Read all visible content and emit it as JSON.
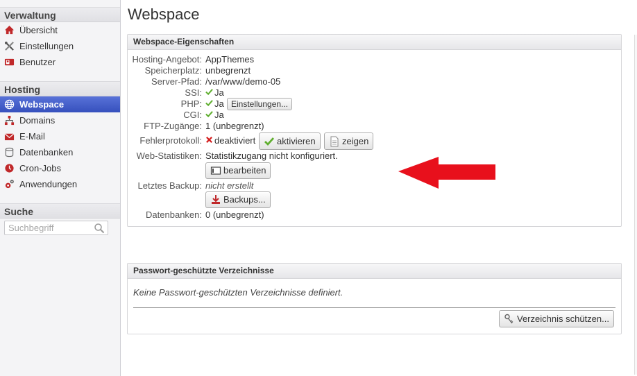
{
  "sidebar": {
    "verwaltung_title": "Verwaltung",
    "verwaltung_items": [
      "Übersicht",
      "Einstellungen",
      "Benutzer"
    ],
    "hosting_title": "Hosting",
    "hosting_items": [
      "Webspace",
      "Domains",
      "E-Mail",
      "Datenbanken",
      "Cron-Jobs",
      "Anwendungen"
    ],
    "active_item": "Webspace",
    "suche_title": "Suche",
    "search_placeholder": "Suchbegriff"
  },
  "main": {
    "page_title": "Webspace",
    "panel1": {
      "title": "Webspace-Eigenschaften",
      "rows": {
        "hosting_label": "Hosting-Angebot:",
        "hosting_value": "AppThemes",
        "speicher_label": "Speicherplatz:",
        "speicher_value": "unbegrenzt",
        "serverpfad_label": "Server-Pfad:",
        "serverpfad_value": "/var/www/demo-05",
        "ssi_label": "SSI:",
        "ssi_value": "Ja",
        "php_label": "PHP:",
        "php_value": "Ja",
        "php_button": "Einstellungen...",
        "cgi_label": "CGI:",
        "cgi_value": "Ja",
        "ftp_label": "FTP-Zugänge:",
        "ftp_value": "1 (unbegrenzt)",
        "fehler_label": "Fehlerprotokoll:",
        "fehler_value": "deaktiviert",
        "aktivieren_button": "aktivieren",
        "zeigen_button": "zeigen",
        "webstat_label": "Web-Statistiken:",
        "webstat_value": "Statistikzugang nicht konfiguriert.",
        "bearbeiten_button": "bearbeiten",
        "backup_label": "Letztes Backup:",
        "backup_value": "nicht erstellt",
        "backups_button": "Backups...",
        "datenbanken_label": "Datenbanken:",
        "datenbanken_value": "0 (unbegrenzt)"
      }
    },
    "panel2": {
      "title": "Passwort-geschützte Verzeichnisse",
      "empty_text": "Keine Passwort-geschützten Verzeichnisse definiert.",
      "protect_button": "Verzeichnis schützen..."
    }
  },
  "colors": {
    "active_nav": "#3f5ac8",
    "annotation_arrow": "#e8101c",
    "check_green": "#5fae2e",
    "error_red": "#d42020"
  }
}
